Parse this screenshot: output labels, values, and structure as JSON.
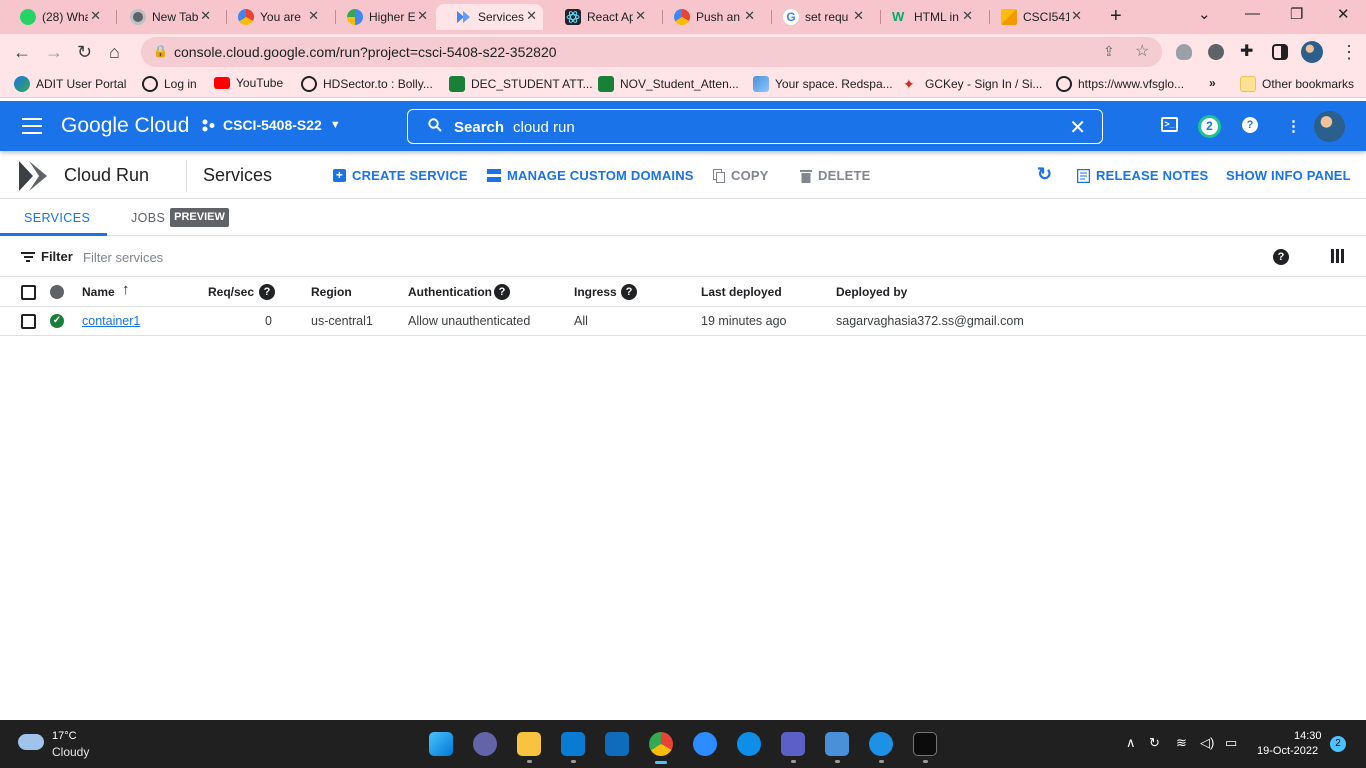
{
  "browser": {
    "tabs": [
      {
        "label": "(28) Wha",
        "favicon": "whatsapp-icon",
        "color": "#25d366"
      },
      {
        "label": "New Tab",
        "favicon": "chrome-icon",
        "color": "#5f6368"
      },
      {
        "label": "You are",
        "favicon": "google-cloud-icon",
        "color": "#f4b400"
      },
      {
        "label": "Higher E",
        "favicon": "globe-icon",
        "color": "#4285f4"
      },
      {
        "label": "Services",
        "favicon": "cloud-run-icon",
        "color": "#4285f4"
      },
      {
        "label": "React Ap",
        "favicon": "react-icon",
        "color": "#61dafb"
      },
      {
        "label": "Push an",
        "favicon": "google-cloud-icon",
        "color": "#ea4335"
      },
      {
        "label": "set requ",
        "favicon": "google-icon",
        "color": "#4285f4"
      },
      {
        "label": "HTML in",
        "favicon": "w3schools-icon",
        "color": "#04aa6d"
      },
      {
        "label": "CSCI541",
        "favicon": "slides-icon",
        "color": "#f4b400"
      }
    ],
    "url": "console.cloud.google.com/run?project=csci-5408-s22-352820",
    "bookmarks": [
      {
        "label": "ADIT User Portal",
        "icon": "bookmark-site-icon"
      },
      {
        "label": "Log in",
        "icon": "globe-icon"
      },
      {
        "label": "YouTube",
        "icon": "youtube-icon"
      },
      {
        "label": "HDSector.to : Bolly...",
        "icon": "globe-icon"
      },
      {
        "label": "DEC_STUDENT ATT...",
        "icon": "sheets-icon"
      },
      {
        "label": "NOV_Student_Atten...",
        "icon": "sheets-icon"
      },
      {
        "label": "Your space. Redspa...",
        "icon": "redspace-icon"
      },
      {
        "label": "GCKey - Sign In / Si...",
        "icon": "maple-leaf-icon"
      },
      {
        "label": "https://www.vfsglo...",
        "icon": "globe-icon"
      }
    ],
    "more_bookmarks": "»",
    "other_bookmarks": "Other bookmarks"
  },
  "console": {
    "logo": "Google Cloud",
    "project": "CSCI-5408-S22",
    "search_label": "Search",
    "search_query": "cloud run",
    "notifications_count": "2"
  },
  "cloudrun": {
    "product": "Cloud Run",
    "page_title": "Services",
    "actions": {
      "create": "CREATE SERVICE",
      "manage_domains": "MANAGE CUSTOM DOMAINS",
      "copy": "COPY",
      "delete": "DELETE",
      "release_notes": "RELEASE NOTES",
      "info_panel": "SHOW INFO PANEL"
    },
    "tabs": {
      "services": "SERVICES",
      "jobs": "JOBS",
      "preview": "PREVIEW"
    },
    "filter": {
      "label": "Filter",
      "placeholder": "Filter services"
    },
    "table": {
      "columns": {
        "name": "Name",
        "req_sec": "Req/sec",
        "region": "Region",
        "authentication": "Authentication",
        "ingress": "Ingress",
        "last_deployed": "Last deployed",
        "deployed_by": "Deployed by"
      },
      "rows": [
        {
          "name": "container1",
          "req_sec": "0",
          "region": "us-central1",
          "authentication": "Allow unauthenticated",
          "ingress": "All",
          "last_deployed": "19 minutes ago",
          "deployed_by": "sagarvaghasia372.ss@gmail.com"
        }
      ]
    }
  },
  "taskbar": {
    "temperature": "17°C",
    "condition": "Cloudy",
    "time": "14:30",
    "date": "19-Oct-2022",
    "notification_count": "2"
  }
}
